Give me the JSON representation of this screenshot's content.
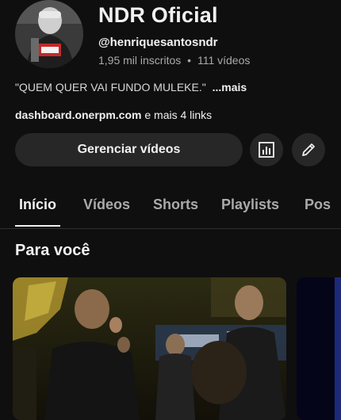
{
  "channel": {
    "name": "NDR Oficial",
    "handle": "@henriquesantosndr",
    "subscribers": "1,95 mil inscritos",
    "separator": "•",
    "video_count": "111 vídeos",
    "description": "\"QUEM QUER VAI FUNDO MULEKE.\"",
    "description_more": "...mais",
    "link_url": "dashboard.onerpm.com",
    "link_more": "e mais 4 links"
  },
  "actions": {
    "manage_videos": "Gerenciar vídeos",
    "analytics_icon": "analytics-icon",
    "edit_icon": "pencil-icon"
  },
  "tabs": [
    {
      "label": "Início",
      "active": true
    },
    {
      "label": "Vídeos",
      "active": false
    },
    {
      "label": "Shorts",
      "active": false
    },
    {
      "label": "Playlists",
      "active": false
    },
    {
      "label": "Pos",
      "active": false
    }
  ],
  "section": {
    "title": "Para você"
  },
  "colors": {
    "background": "#0f0f0f",
    "button_bg": "#272727",
    "secondary_text": "#aaaaaa"
  }
}
